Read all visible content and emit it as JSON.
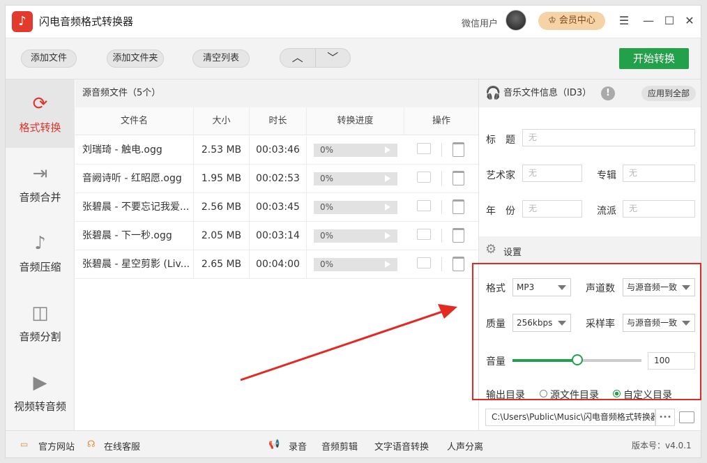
{
  "app": {
    "title": "闪电音频格式转换器",
    "user_name": "微信用户",
    "vip_label": "会员中心"
  },
  "toolbar": {
    "add_file": "添加文件",
    "add_folder": "添加文件夹",
    "clear_list": "清空列表",
    "move_up": "︿",
    "move_down": "﹀",
    "start": "开始转换"
  },
  "nav": [
    {
      "label": "格式转换",
      "icon": "refresh-icon"
    },
    {
      "label": "音频合并",
      "icon": "merge-icon"
    },
    {
      "label": "音频压缩",
      "icon": "music-note-icon"
    },
    {
      "label": "音频分割",
      "icon": "split-icon"
    },
    {
      "label": "视频转音频",
      "icon": "video-icon"
    }
  ],
  "file_list": {
    "header": "源音频文件（5个）",
    "columns": [
      "文件名",
      "大小",
      "时长",
      "转换进度",
      "操作"
    ],
    "rows": [
      {
        "name": "刘瑞琦 - 触电.ogg",
        "size": "2.53 MB",
        "duration": "00:03:46",
        "progress": "0%"
      },
      {
        "name": "音阙诗听 - 红昭愿.ogg",
        "size": "1.95 MB",
        "duration": "00:02:53",
        "progress": "0%"
      },
      {
        "name": "张碧晨 - 不要忘记我爱...",
        "size": "2.56 MB",
        "duration": "00:03:45",
        "progress": "0%"
      },
      {
        "name": "张碧晨 - 下一秒.ogg",
        "size": "2.05 MB",
        "duration": "00:03:14",
        "progress": "0%"
      },
      {
        "name": "张碧晨 - 星空剪影 (Liv...",
        "size": "2.65 MB",
        "duration": "00:04:00",
        "progress": "0%"
      }
    ]
  },
  "id3": {
    "header": "音乐文件信息（ID3）",
    "apply_all": "应用到全部",
    "title_label": "标　题",
    "artist_label": "艺术家",
    "album_label": "专辑",
    "year_label": "年　份",
    "genre_label": "流派",
    "placeholder": "无"
  },
  "settings": {
    "header": "设置",
    "format_label": "格式",
    "format_value": "MP3",
    "channels_label": "声道数",
    "channels_value": "与源音频一致",
    "quality_label": "质量",
    "quality_value": "256kbps",
    "samplerate_label": "采样率",
    "samplerate_value": "与源音频一致",
    "volume_label": "音量",
    "volume_value": "100",
    "volume_fraction": 0.5,
    "output_label": "输出目录",
    "output_source": "源文件目录",
    "output_custom": "自定义目录",
    "output_path": "C:\\Users\\Public\\Music\\闪电音频格式转换器",
    "more": "•••"
  },
  "footer": {
    "website": "官方网站",
    "support": "在线客服",
    "record": "录音",
    "audio_cut": "音频剪辑",
    "tts": "文字语音转换",
    "vocal": "人声分离",
    "version": "版本号：v4.0.1"
  },
  "colors": {
    "accent_red": "#e0362c",
    "start_green": "#22a04a",
    "vip_gold": "#f6d3a6"
  }
}
